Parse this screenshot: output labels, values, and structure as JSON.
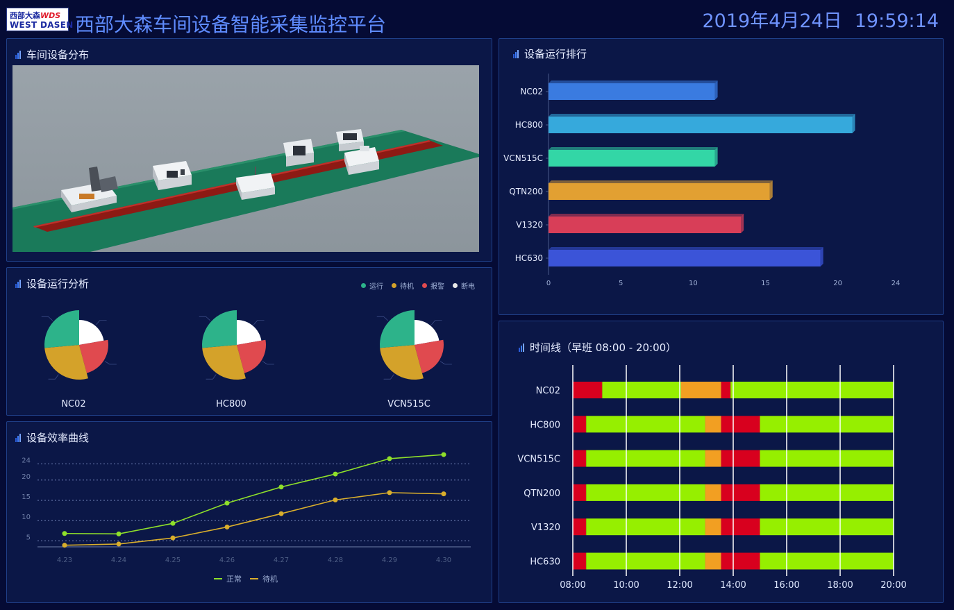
{
  "header": {
    "logo_cn": "西部大森",
    "logo_wds": "WDS",
    "logo_en": "WEST DASEN",
    "title": "西部大森车间设备智能采集监控平台",
    "date": "2019年4月24日",
    "time": "19:59:14"
  },
  "panels": {
    "layout_title": "车间设备分布",
    "analysis_title": "设备运行分析",
    "ranking_title": "设备运行排行",
    "efficiency_title": "设备效率曲线",
    "timeline_title": "时间线（早班 08:00 - 20:00）"
  },
  "colors": {
    "running": "#2db38a",
    "standby": "#d4a22a",
    "alarm": "#e04a4f",
    "poweroff": "#ffffff",
    "tl_alarm": "#d8001e",
    "tl_normal": "#96ef00",
    "tl_standby": "#f29f22"
  },
  "analysis": {
    "legend": [
      {
        "label": "运行",
        "color": "#2db38a"
      },
      {
        "label": "待机",
        "color": "#d4a22a"
      },
      {
        "label": "报警",
        "color": "#e04a4f"
      },
      {
        "label": "断电",
        "color": "#e8e8e8"
      }
    ],
    "machines": [
      {
        "name": "NC02",
        "running": 30,
        "standby": 28,
        "alarm": 22,
        "poweroff": 20
      },
      {
        "name": "HC800",
        "running": 30,
        "standby": 28,
        "alarm": 22,
        "poweroff": 20
      },
      {
        "name": "VCN515C",
        "running": 30,
        "standby": 28,
        "alarm": 22,
        "poweroff": 20
      }
    ]
  },
  "chart_data": [
    {
      "type": "bar",
      "orientation": "horizontal",
      "categories": [
        "NC02",
        "HC800",
        "VCN515C",
        "QTN200",
        "V1320",
        "HC630"
      ],
      "values": [
        11.5,
        21,
        11.5,
        15.3,
        13.3,
        18.8
      ],
      "colors": [
        "#3a7be0",
        "#36a9dc",
        "#33d6a6",
        "#e2a032",
        "#d83e58",
        "#3b54d8"
      ],
      "xlim": [
        0,
        24
      ],
      "xticks": [
        0,
        5,
        10,
        15,
        20,
        24
      ]
    },
    {
      "type": "line",
      "x": [
        "4.23",
        "4.24",
        "4.25",
        "4.26",
        "4.27",
        "4.28",
        "4.29",
        "4.30"
      ],
      "series": [
        {
          "name": "正常",
          "color": "#8fe02a",
          "values": [
            6.8,
            6.7,
            9.3,
            14.3,
            18.3,
            21.5,
            25.3,
            26.3
          ]
        },
        {
          "name": "待机",
          "color": "#d9ae2c",
          "values": [
            3.9,
            4.2,
            5.7,
            8.4,
            11.7,
            15.1,
            16.9,
            16.6
          ]
        }
      ],
      "yticks": [
        5,
        10,
        15,
        20,
        24
      ],
      "ylim": [
        3.5,
        27
      ]
    },
    {
      "type": "timeline",
      "categories": [
        "NC02",
        "HC800",
        "VCN515C",
        "QTN200",
        "V1320",
        "HC630"
      ],
      "xticks": [
        "08:00",
        "10:00",
        "12:00",
        "14:00",
        "16:00",
        "18:00",
        "20:00"
      ],
      "range_hours": [
        8,
        20
      ],
      "rows": [
        [
          [
            8.0,
            9.1,
            "alarm"
          ],
          [
            9.1,
            12.05,
            "normal"
          ],
          [
            12.05,
            13.55,
            "standby"
          ],
          [
            13.55,
            13.9,
            "alarm"
          ],
          [
            13.9,
            20.0,
            "normal"
          ]
        ],
        [
          [
            8.0,
            8.5,
            "alarm"
          ],
          [
            8.5,
            12.95,
            "normal"
          ],
          [
            12.95,
            13.55,
            "standby"
          ],
          [
            13.55,
            15.0,
            "alarm"
          ],
          [
            15.0,
            20.0,
            "normal"
          ]
        ],
        [
          [
            8.0,
            8.5,
            "alarm"
          ],
          [
            8.5,
            12.95,
            "normal"
          ],
          [
            12.95,
            13.55,
            "standby"
          ],
          [
            13.55,
            15.0,
            "alarm"
          ],
          [
            15.0,
            20.0,
            "normal"
          ]
        ],
        [
          [
            8.0,
            8.5,
            "alarm"
          ],
          [
            8.5,
            12.95,
            "normal"
          ],
          [
            12.95,
            13.55,
            "standby"
          ],
          [
            13.55,
            15.0,
            "alarm"
          ],
          [
            15.0,
            20.0,
            "normal"
          ]
        ],
        [
          [
            8.0,
            8.5,
            "alarm"
          ],
          [
            8.5,
            12.95,
            "normal"
          ],
          [
            12.95,
            13.55,
            "standby"
          ],
          [
            13.55,
            15.0,
            "alarm"
          ],
          [
            15.0,
            20.0,
            "normal"
          ]
        ],
        [
          [
            8.0,
            8.5,
            "alarm"
          ],
          [
            8.5,
            12.95,
            "normal"
          ],
          [
            12.95,
            13.55,
            "standby"
          ],
          [
            13.55,
            15.0,
            "alarm"
          ],
          [
            15.0,
            20.0,
            "normal"
          ]
        ]
      ]
    }
  ]
}
